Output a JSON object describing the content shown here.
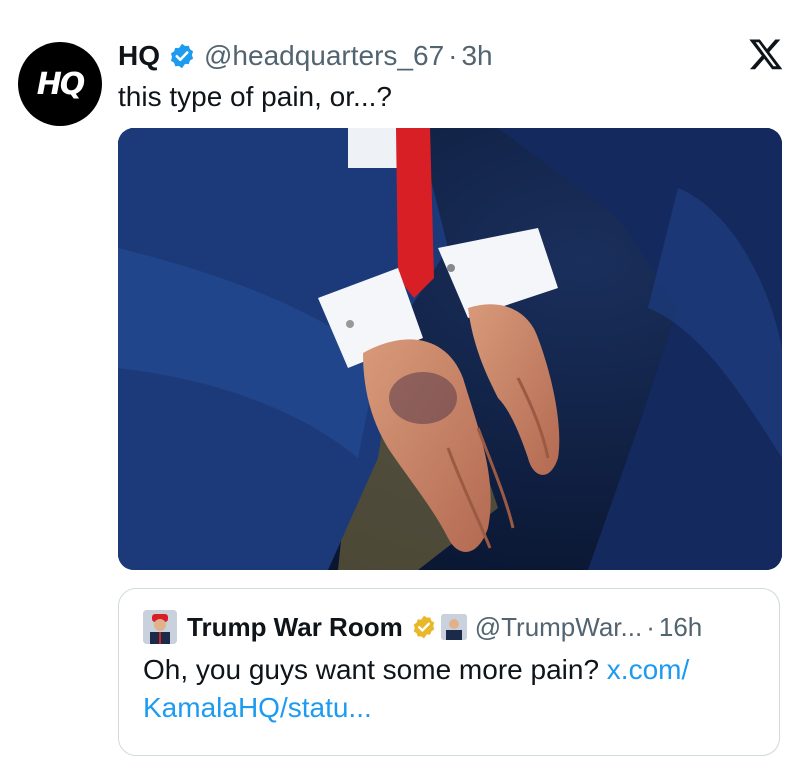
{
  "tweet": {
    "avatar_text": "HQ",
    "name": "HQ",
    "handle": "@headquarters_67",
    "separator": "·",
    "time": "3h",
    "text": "this type of pain, or...?",
    "verified_icon": "blue-check-icon",
    "close_icon": "x-logo-icon"
  },
  "quote": {
    "name": "Trump War Room",
    "handle": "@TrumpWar...",
    "separator": "·",
    "time": "16h",
    "text": "Oh, you guys want some more pain?",
    "link_line1": "x.com/",
    "link_line2": "KamalaHQ/statu..."
  },
  "colors": {
    "accent": "#1d9bf0",
    "gold_badge": "#e8b829",
    "muted": "#536471",
    "text": "#0f1419"
  }
}
